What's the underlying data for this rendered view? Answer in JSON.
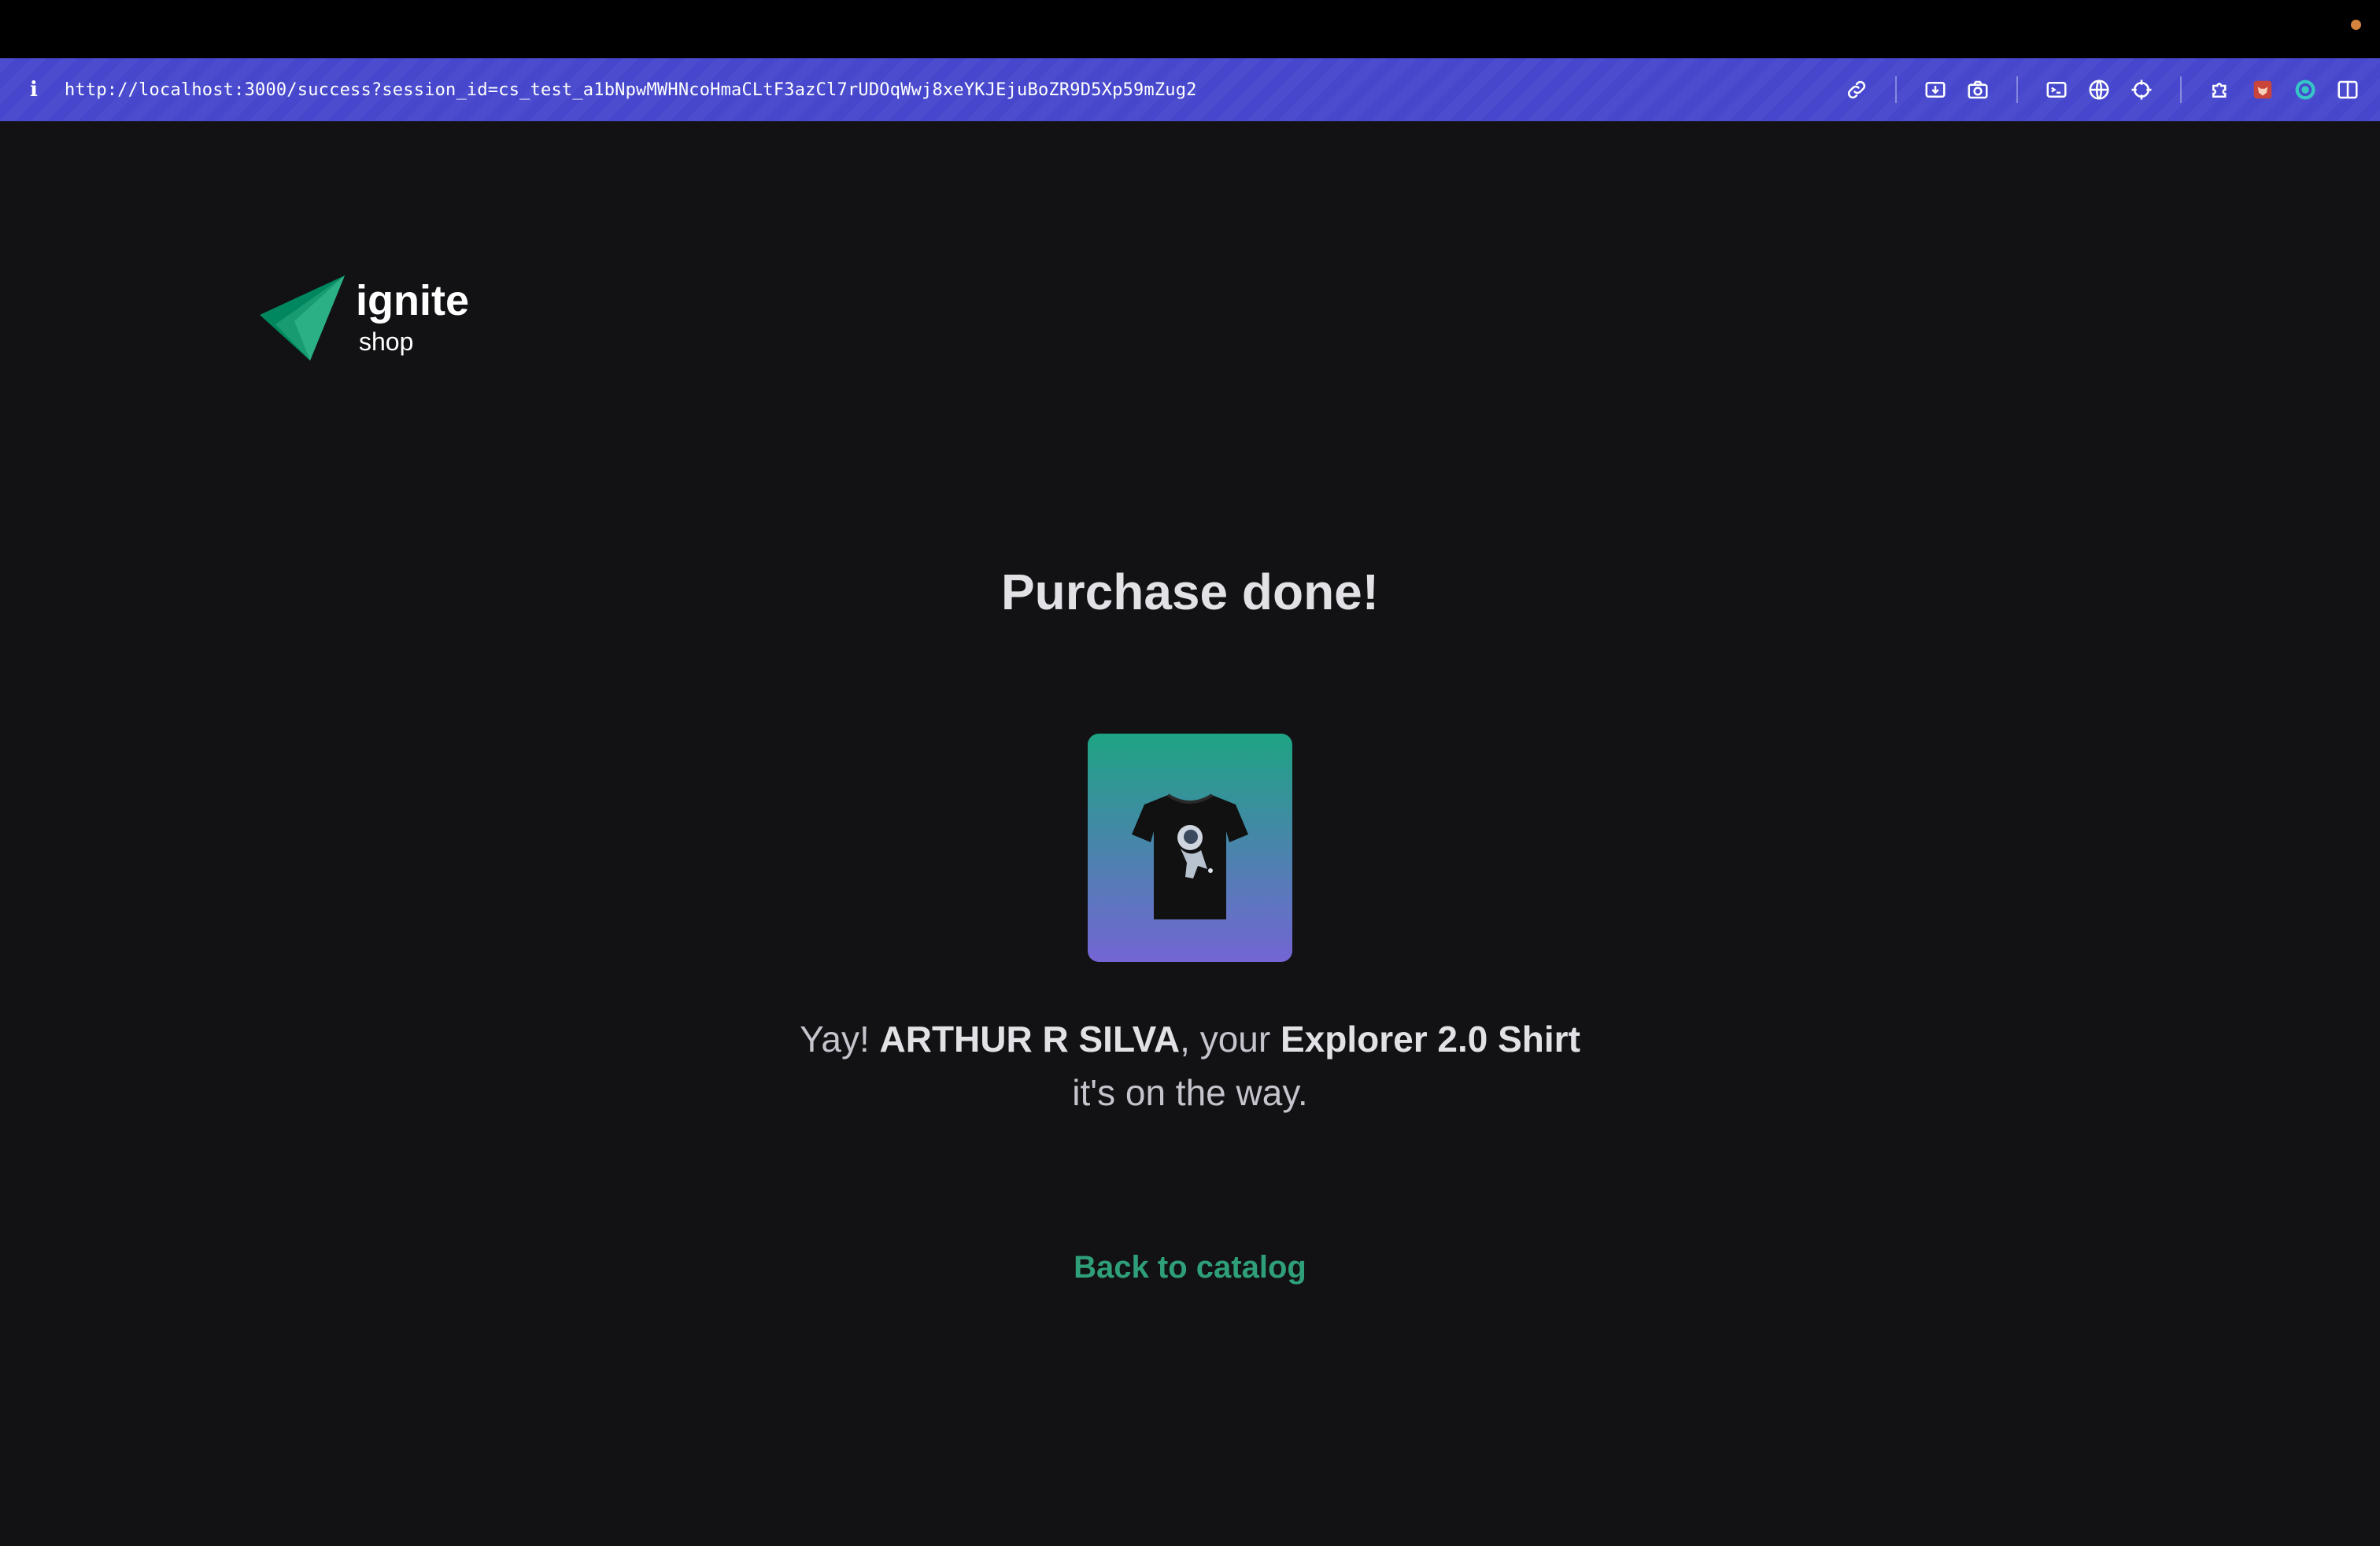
{
  "browser": {
    "url": "http://localhost:3000/success?session_id=cs_test_a1bNpwMWHNcoHmaCLtF3azCl7rUDOqWwj8xeYKJEjuBoZR9D5Xp59mZug2",
    "info_icon": "info-icon",
    "toolbar_icons": [
      "link-icon",
      "screenshot-area-icon",
      "camera-icon",
      "terminal-icon",
      "globe-icon",
      "crosshair-icon",
      "puzzle-extension-icon",
      "fox-extension-icon",
      "record-icon",
      "sidebar-toggle-icon"
    ],
    "accent": "#4647cc"
  },
  "header": {
    "logo_word": "ignite",
    "logo_sub": "shop",
    "logo_color": "#00b37e"
  },
  "main": {
    "title": "Purchase done!",
    "product_image_alt": "black t-shirt with astronaut print",
    "message": {
      "prefix": "Yay! ",
      "customer_name": "ARTHUR R SILVA",
      "middle": ", your ",
      "product_name": "Explorer 2.0 Shirt",
      "suffix": "it's on the way."
    },
    "back_link": "Back to catalog",
    "link_color": "#00875f"
  }
}
